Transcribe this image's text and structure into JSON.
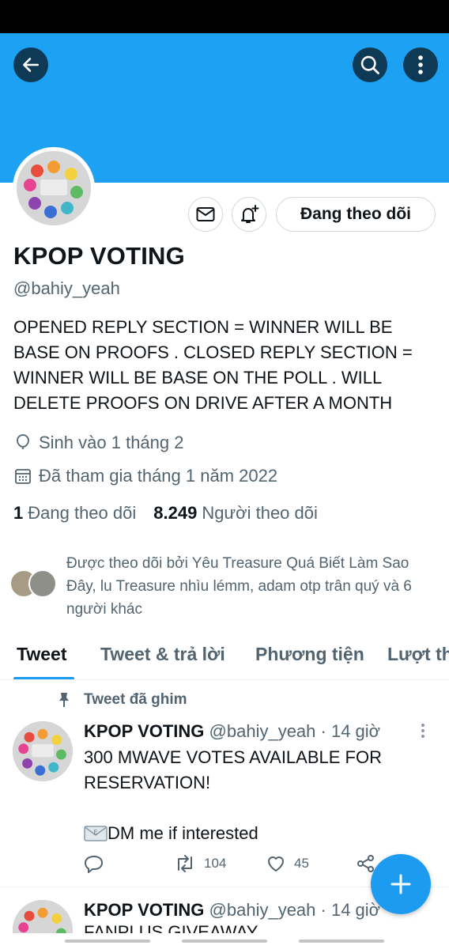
{
  "profile": {
    "name": "KPOP VOTING",
    "handle": "@bahiy_yeah",
    "bio": "OPENED REPLY SECTION = WINNER WILL BE BASE ON PROOFS .  CLOSED REPLY SECTION = WINNER WILL BE BASE ON THE POLL . WILL DELETE PROOFS ON DRIVE AFTER A MONTH",
    "birthday": "Sinh vào 1 tháng 2",
    "joined": "Đã tham gia tháng 1 năm 2022",
    "following_count": "1",
    "following_label": "Đang theo dõi",
    "followers_count": "8.249",
    "followers_label": "Người theo dõi",
    "followed_by": "Được theo dõi bởi Yêu Treasure Quá Biết Làm Sao Đây, lu Treasure nhìu lémm, adam otp trân quý và 6 người khác"
  },
  "buttons": {
    "following_label": "Đang theo dõi"
  },
  "tabs": [
    {
      "label": "Tweet",
      "active": true
    },
    {
      "label": "Tweet & trả lời",
      "active": false
    },
    {
      "label": "Phương tiện",
      "active": false
    },
    {
      "label": "Lượt thích",
      "active": false
    }
  ],
  "pinned_label": "Tweet đã ghim",
  "tweets": [
    {
      "name": "KPOP VOTING",
      "handle": "@bahiy_yeah",
      "time": "· 14 giờ",
      "text_line1": "300 MWAVE VOTES AVAILABLE FOR RESERVATION!",
      "text_line2": "DM me if interested",
      "retweets": "104",
      "likes": "45"
    },
    {
      "name": "KPOP VOTING",
      "handle": "@bahiy_yeah",
      "time": "· 14 giờ",
      "text_line1": "FANPLUS GIVEAWAY"
    }
  ],
  "colors": {
    "brand": "#1da1f2",
    "accent": "#1d9bf0",
    "muted_text": "#536471"
  },
  "icons": [
    "back-arrow-icon",
    "search-icon",
    "more-vertical-icon",
    "envelope-icon",
    "bell-plus-icon",
    "balloon-icon",
    "calendar-icon",
    "pin-icon",
    "reply-icon",
    "retweet-icon",
    "heart-icon",
    "share-icon",
    "plus-icon"
  ]
}
